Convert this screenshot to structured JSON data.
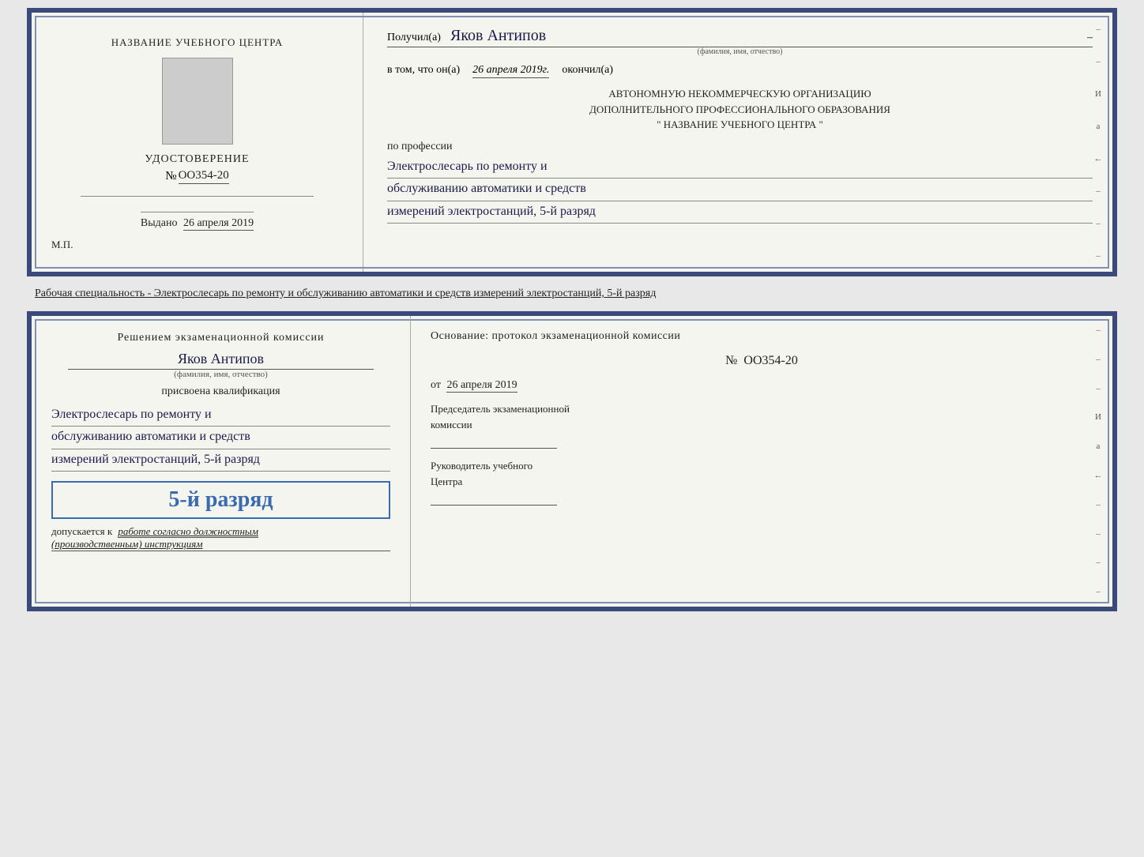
{
  "top_cert": {
    "left": {
      "org_name": "НАЗВАНИЕ УЧЕБНОГО ЦЕНТРА",
      "udostoverenie_title": "УДОСТОВЕРЕНИЕ",
      "number_prefix": "№",
      "number": "OO354-20",
      "vyidano_prefix": "Выдано",
      "vyidano_date": "26 апреля 2019",
      "mp": "М.П."
    },
    "right": {
      "poluchil_prefix": "Получил(а)",
      "poluchil_name": "Яков Антипов",
      "poluchil_sublabel": "(фамилия, имя, отчество)",
      "vtom_prefix": "в том, что он(а)",
      "vtom_date": "26 апреля 2019г.",
      "okonchil": "окончил(а)",
      "org_line1": "АВТОНОМНУЮ НЕКОММЕРЧЕСКУЮ ОРГАНИЗАЦИЮ",
      "org_line2": "ДОПОЛНИТЕЛЬНОГО ПРОФЕССИОНАЛЬНОГО ОБРАЗОВАНИЯ",
      "org_line3": "\"  НАЗВАНИЕ УЧЕБНОГО ЦЕНТРА  \"",
      "po_professii": "по профессии",
      "profession_line1": "Электрослесарь по ремонту и",
      "profession_line2": "обслуживанию автоматики и средств",
      "profession_line3": "измерений электростанций, 5-й разряд"
    }
  },
  "specialty_text": "Рабочая специальность - Электрослесарь по ремонту и обслуживанию автоматики и средств\nизмерений электростанций, 5-й разряд",
  "bottom_cert": {
    "left": {
      "resheniem": "Решением экзаменационной комиссии",
      "fio": "Яков Антипов",
      "fio_sublabel": "(фамилия, имя, отчество)",
      "prisvoena": "присвоена квалификация",
      "qual_line1": "Электрослесарь по ремонту и",
      "qual_line2": "обслуживанию автоматики и средств",
      "qual_line3": "измерений электростанций, 5-й разряд",
      "razryad_big": "5-й разряд",
      "dopuskaetsya_prefix": "допускается к",
      "dopuskaetsya_text": "работе согласно должностным",
      "dopuskaetsya_text2": "(производственным) инструкциям"
    },
    "right": {
      "osnovanie_title": "Основание: протокол экзаменационной комиссии",
      "number_prefix": "№",
      "number": "OO354-20",
      "ot_prefix": "от",
      "ot_date": "26 апреля 2019",
      "predsedatel_title": "Председатель экзаменационной",
      "predsedatel_title2": "комиссии",
      "rukovoditel_title": "Руководитель учебного",
      "rukovoditel_title2": "Центра"
    }
  },
  "side_deco": {
    "items": [
      "И",
      "а",
      "←",
      "–",
      "–",
      "–",
      "–",
      "–"
    ]
  }
}
